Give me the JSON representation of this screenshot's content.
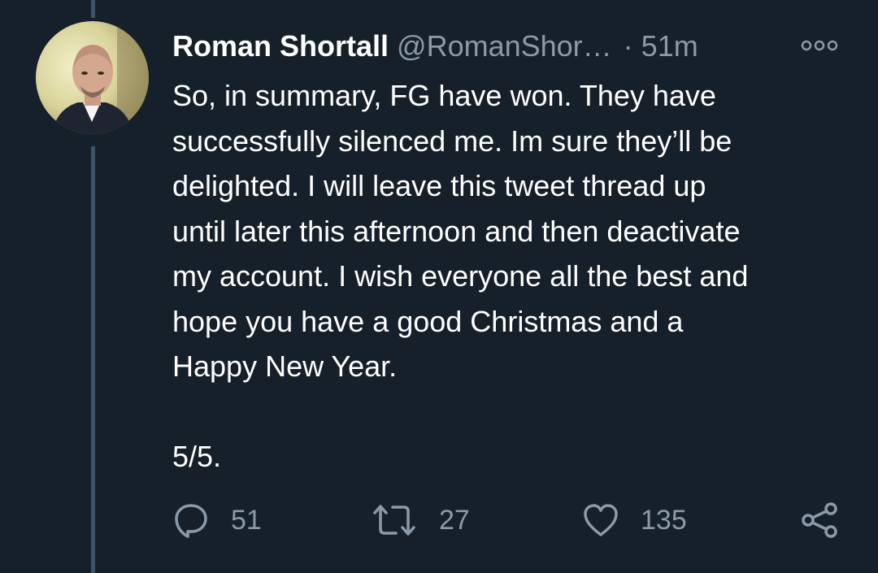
{
  "tweet": {
    "author_name": "Roman Shortall",
    "handle": "@RomanShor…",
    "separator": "·",
    "time": "51m",
    "text": "So, in summary, FG have won. They have\nsuccessfully silenced me. Im sure they’ll be\ndelighted. I will leave this tweet thread up\nuntil later this afternoon and then deactivate\nmy account. I wish everyone all the best and\nhope you have a good Christmas and a\nHappy New Year.\n\n5/5."
  },
  "actions": {
    "replies": "51",
    "retweets": "27",
    "likes": "135"
  },
  "icons": {
    "more": "more-options-icon",
    "reply": "reply-icon",
    "retweet": "retweet-icon",
    "like": "heart-icon",
    "share": "share-icon"
  },
  "colors": {
    "background": "#16202b",
    "secondary_text": "#8a9aa8",
    "thread_line": "#3d5466"
  }
}
